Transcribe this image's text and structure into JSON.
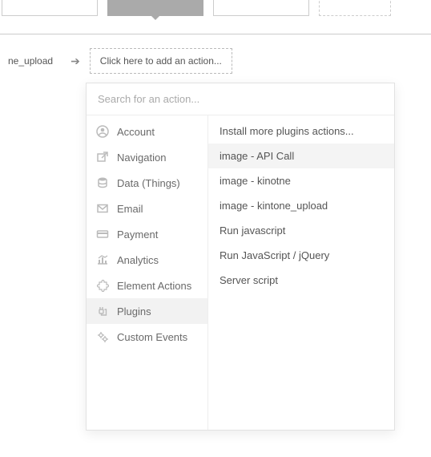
{
  "flow": {
    "prev_label": "ne_upload",
    "add_action_label": "Click here to add an action..."
  },
  "dropdown": {
    "search_placeholder": "Search for an action...",
    "categories": [
      {
        "key": "account",
        "label": "Account",
        "icon": "user-circle-icon",
        "selected": false
      },
      {
        "key": "nav",
        "label": "Navigation",
        "icon": "external-link-icon",
        "selected": false
      },
      {
        "key": "data",
        "label": "Data (Things)",
        "icon": "database-icon",
        "selected": false
      },
      {
        "key": "email",
        "label": "Email",
        "icon": "envelope-icon",
        "selected": false
      },
      {
        "key": "payment",
        "label": "Payment",
        "icon": "credit-card-icon",
        "selected": false
      },
      {
        "key": "analytics",
        "label": "Analytics",
        "icon": "chart-icon",
        "selected": false
      },
      {
        "key": "elements",
        "label": "Element Actions",
        "icon": "puzzle-icon",
        "selected": false
      },
      {
        "key": "plugins",
        "label": "Plugins",
        "icon": "plug-icon",
        "selected": true
      },
      {
        "key": "custom",
        "label": "Custom Events",
        "icon": "gears-icon",
        "selected": false
      }
    ],
    "actions": [
      {
        "label": "Install more plugins actions...",
        "highlight": false
      },
      {
        "label": "image - API Call",
        "highlight": true
      },
      {
        "label": "image - kinotne",
        "highlight": false
      },
      {
        "label": "image - kintone_upload",
        "highlight": false
      },
      {
        "label": "Run javascript",
        "highlight": false
      },
      {
        "label": "Run JavaScript / jQuery",
        "highlight": false
      },
      {
        "label": "Server script",
        "highlight": false
      }
    ]
  }
}
